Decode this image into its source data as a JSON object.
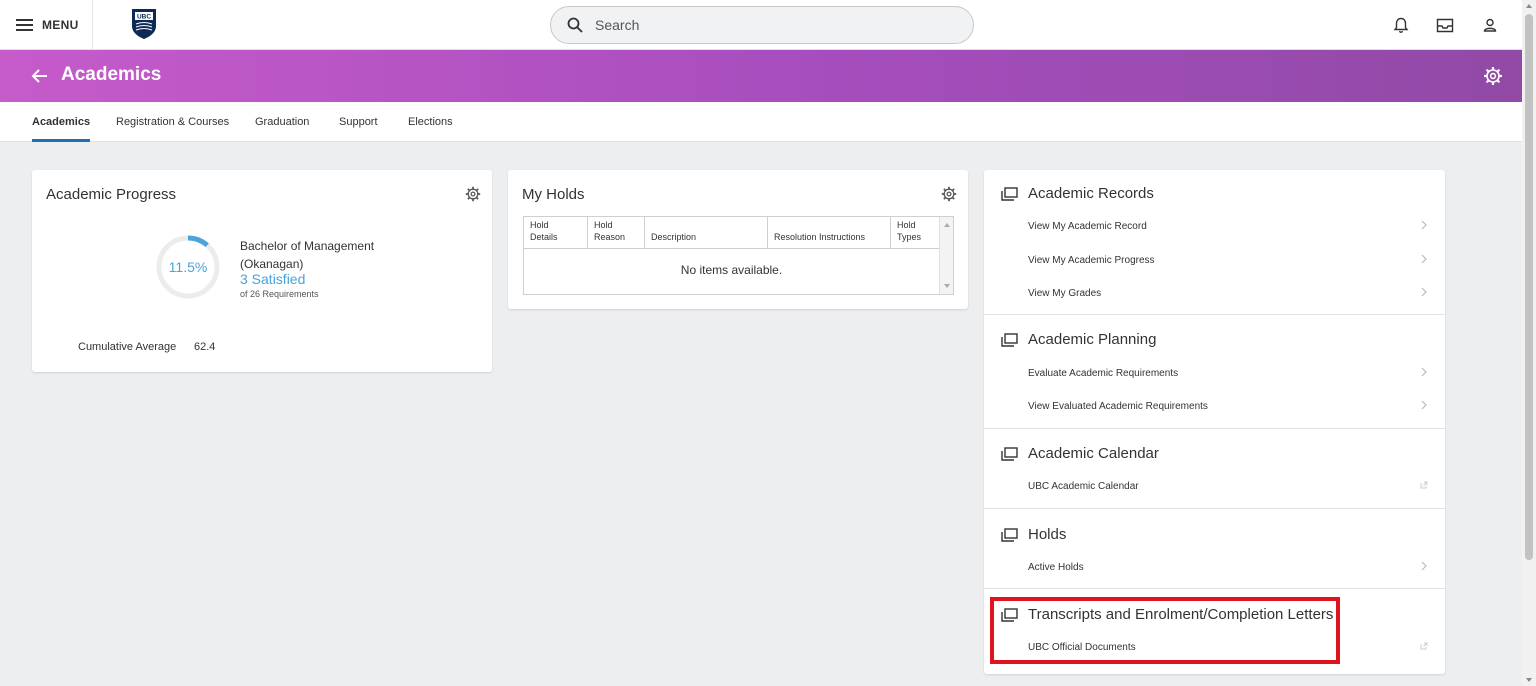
{
  "topbar": {
    "menu_label": "MENU",
    "logo_text": "UBC",
    "search_placeholder": "Search"
  },
  "banner": {
    "title": "Academics"
  },
  "tabs": [
    {
      "label": "Academics",
      "active": true
    },
    {
      "label": "Registration & Courses",
      "active": false
    },
    {
      "label": "Graduation",
      "active": false
    },
    {
      "label": "Support",
      "active": false
    },
    {
      "label": "Elections",
      "active": false
    }
  ],
  "academic_progress": {
    "title": "Academic Progress",
    "percent_text": "11.5%",
    "percent_value": 11.5,
    "degree_line1": "Bachelor of Management",
    "degree_line2": "(Okanagan)",
    "satisfied": "3 Satisfied",
    "requirements": "of 26 Requirements",
    "cumulative_label": "Cumulative Average",
    "cumulative_value": "62.4"
  },
  "my_holds": {
    "title": "My Holds",
    "columns": [
      {
        "line1": "Hold",
        "line2": "Details"
      },
      {
        "line1": "Hold",
        "line2": "Reason"
      },
      {
        "line1": "",
        "line2": "Description"
      },
      {
        "line1": "",
        "line2": "Resolution Instructions"
      },
      {
        "line1": "Hold",
        "line2": "Types"
      }
    ],
    "empty_text": "No items available."
  },
  "right_panel": {
    "sections": [
      {
        "title": "Academic Records",
        "links": [
          {
            "label": "View My Academic Record",
            "type": "chevron"
          },
          {
            "label": "View My Academic Progress",
            "type": "chevron"
          },
          {
            "label": "View My Grades",
            "type": "chevron"
          }
        ]
      },
      {
        "title": "Academic Planning",
        "links": [
          {
            "label": "Evaluate Academic Requirements",
            "type": "chevron"
          },
          {
            "label": "View Evaluated Academic Requirements",
            "type": "chevron"
          }
        ]
      },
      {
        "title": "Academic Calendar",
        "links": [
          {
            "label": "UBC Academic Calendar",
            "type": "external"
          }
        ]
      },
      {
        "title": "Holds",
        "links": [
          {
            "label": "Active Holds",
            "type": "chevron"
          }
        ]
      },
      {
        "title": "Transcripts and Enrolment/Completion Letters",
        "links": [
          {
            "label": "UBC Official Documents",
            "type": "external"
          }
        ]
      }
    ]
  },
  "colors": {
    "banner_start": "#c65bca",
    "banner_end": "#914aa6",
    "accent_blue": "#4aa3d9",
    "tab_underline": "#1e6fb8",
    "highlight_red": "#e0141e"
  },
  "icons": [
    "menu-icon",
    "ubc-logo",
    "search-icon",
    "bell-icon",
    "inbox-icon",
    "user-icon",
    "back-arrow-icon",
    "gear-icon",
    "window-icon",
    "chevron-right-icon",
    "external-link-icon"
  ]
}
